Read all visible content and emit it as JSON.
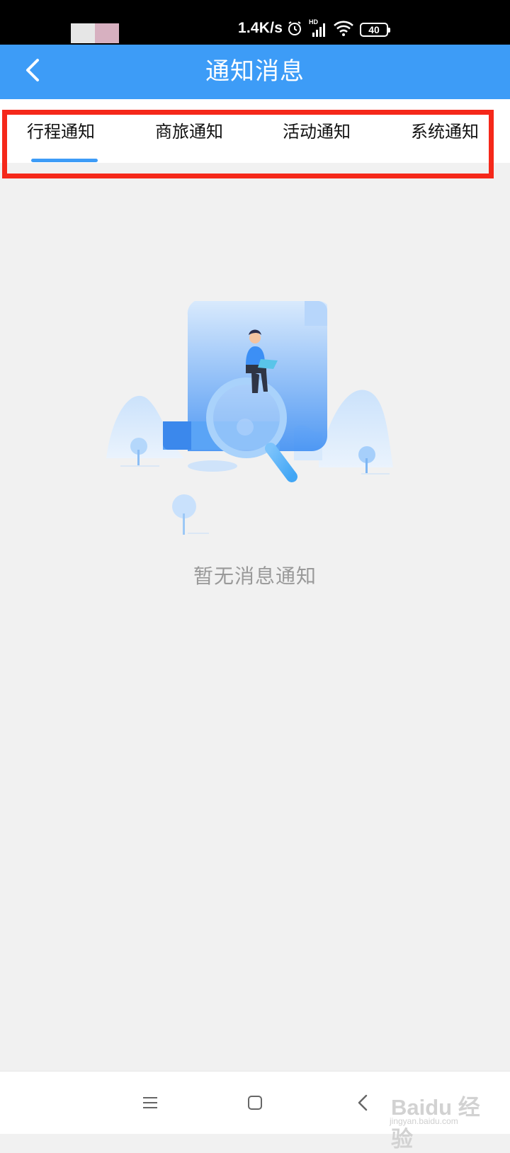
{
  "status_bar": {
    "network_speed": "1.4K/s",
    "network_type": "HD",
    "battery_level": "40",
    "icons": [
      "alarm-icon",
      "signal-icon",
      "wifi-icon",
      "battery-icon"
    ]
  },
  "header": {
    "back_icon": "chevron-left-icon",
    "title": "通知消息"
  },
  "tabs": [
    {
      "label": "行程通知",
      "selected": true
    },
    {
      "label": "商旅通知",
      "selected": false
    },
    {
      "label": "活动通知",
      "selected": false
    },
    {
      "label": "系统通知",
      "selected": false
    }
  ],
  "empty_state": {
    "illustration": "person-on-magnifier-illustration",
    "text": "暂无消息通知"
  },
  "bottom_nav": {
    "icons": [
      "menu-icon",
      "home-square-icon",
      "back-chevron-icon"
    ]
  },
  "watermark": {
    "main": "Baidu 经验",
    "sub": "jingyan.baidu.com"
  },
  "colors": {
    "accent": "#3d9cf7",
    "highlight": "#f5281a",
    "background": "#f1f1f1"
  }
}
